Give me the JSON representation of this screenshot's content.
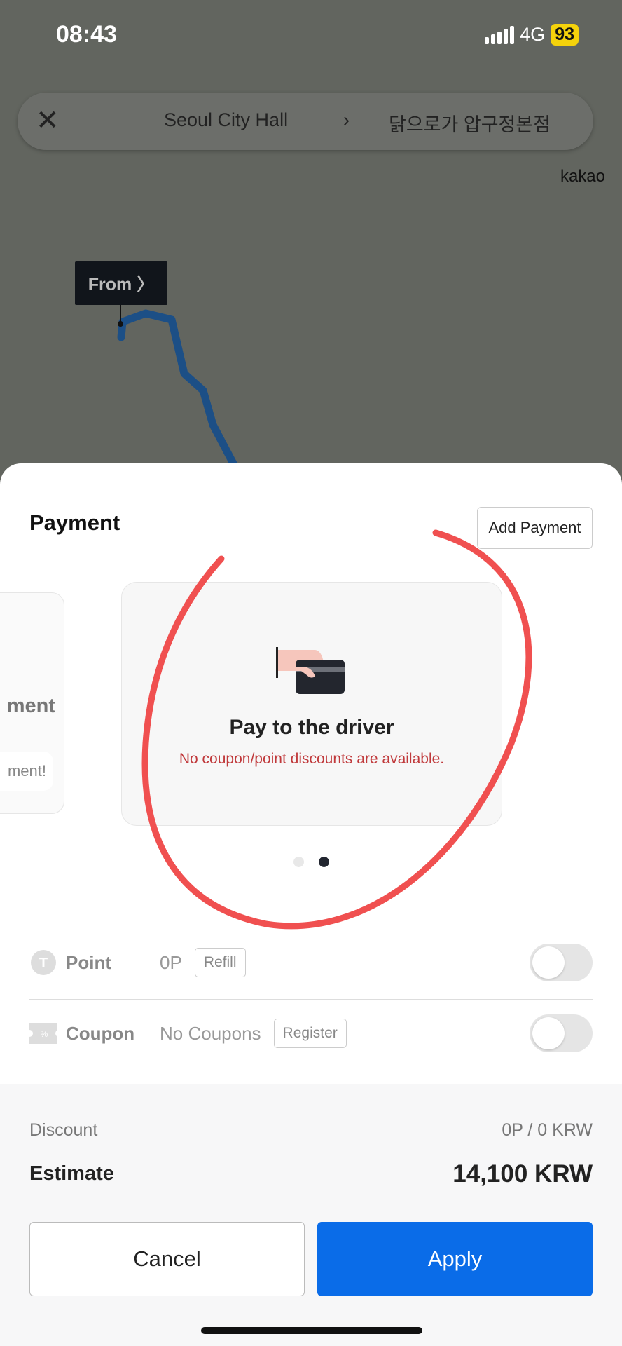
{
  "status_bar": {
    "time": "08:43",
    "network": "4G",
    "battery": "93"
  },
  "route_bar": {
    "from": "Seoul City Hall",
    "to": "닭으로가 압구정본점",
    "chevron": "›"
  },
  "map": {
    "attribution": "kakao",
    "from_tag": "From 〉",
    "route_color": "#1c4f86"
  },
  "payment": {
    "title": "Payment",
    "add_payment": "Add Payment",
    "left_card": {
      "title": "ment",
      "button": "ment!"
    },
    "card": {
      "title": "Pay to the driver",
      "note": "No coupon/point discounts are available.",
      "icon": "hand-card-icon"
    },
    "page_indicator": {
      "pages": 2,
      "current": 2
    }
  },
  "point": {
    "label": "Point",
    "value": "0P",
    "button": "Refill",
    "enabled": false,
    "icon": "point-icon"
  },
  "coupon": {
    "label": "Coupon",
    "value": "No Coupons",
    "button": "Register",
    "enabled": false,
    "icon": "coupon-icon"
  },
  "summary": {
    "discount_label": "Discount",
    "discount_value": "0P / 0 KRW",
    "estimate_label": "Estimate",
    "estimate_value": "14,100 KRW"
  },
  "actions": {
    "cancel": "Cancel",
    "apply": "Apply"
  },
  "colors": {
    "accent": "#0a6ce8",
    "warning": "#c0393b",
    "annotation": "#f05050"
  }
}
